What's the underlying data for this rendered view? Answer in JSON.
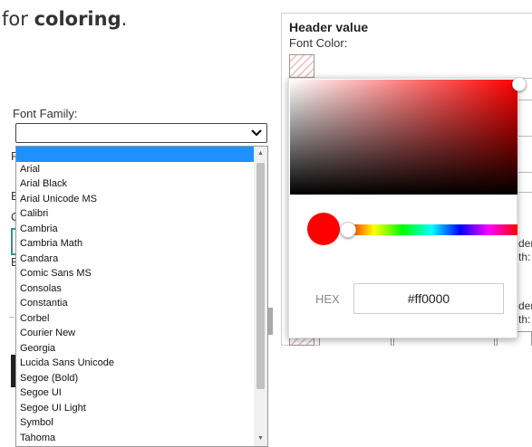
{
  "intro": {
    "prefix": "for ",
    "bold": "coloring",
    "suffix": "."
  },
  "left": {
    "font_family_label": "Font Family:",
    "dropdown_value": "",
    "options": [
      "",
      "Arial",
      "Arial Black",
      "Arial Unicode MS",
      "Calibri",
      "Cambria",
      "Cambria Math",
      "Candara",
      "Comic Sans MS",
      "Consolas",
      "Constantia",
      "Corbel",
      "Courier New",
      "Georgia",
      "Lucida Sans Unicode",
      "Segoe (Bold)",
      "Segoe UI",
      "Segoe UI Light",
      "Symbol",
      "Tahoma"
    ],
    "selected_index": 0,
    "background_letters": [
      "F",
      "E",
      "C",
      "E"
    ]
  },
  "right": {
    "header_title": "Header value",
    "font_color_label": "Font Color:",
    "hex_label": "HEX",
    "hex_value": "#ff0000",
    "background_fragments": [
      "der",
      "th:",
      "der",
      "th:"
    ]
  },
  "colors": {
    "selected_color": "#ff0000",
    "highlight": "#1e90ff"
  },
  "icons": {
    "dropdown_chevron": "chevron-down-icon",
    "scroll_up": "scroll-up-arrow-icon",
    "scroll_down": "scroll-down-arrow-icon"
  }
}
